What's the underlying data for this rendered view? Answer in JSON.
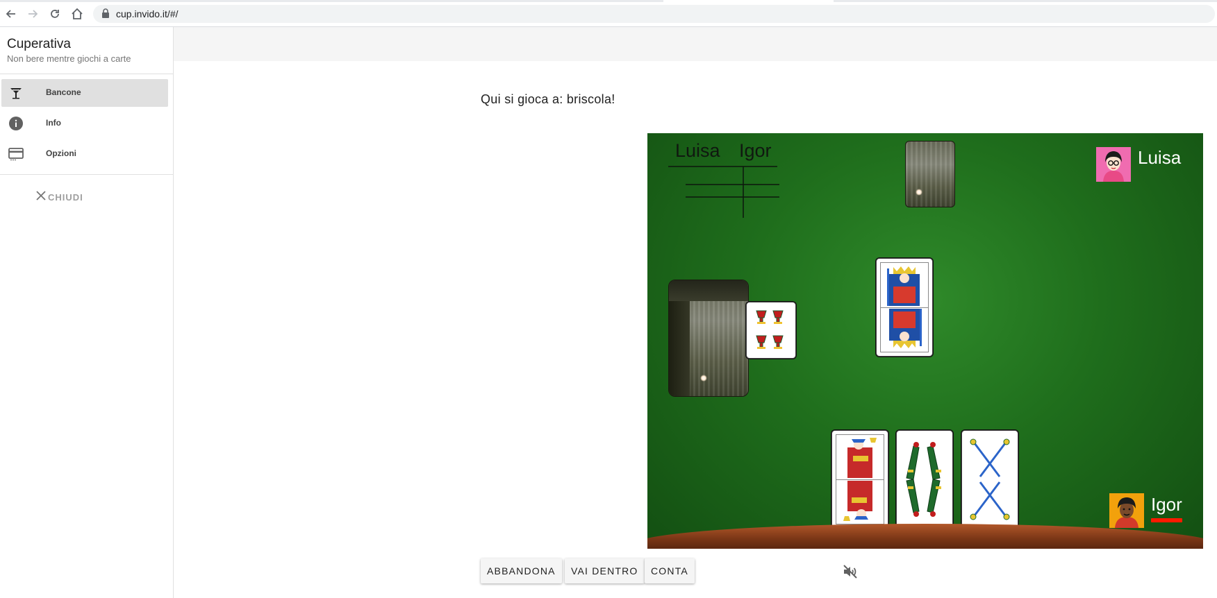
{
  "browser": {
    "url": "cup.invido.it/#/"
  },
  "sidebar": {
    "title": "Cuperativa",
    "subtitle": "Non bere mentre giochi a carte",
    "items": [
      {
        "label": "Bancone",
        "icon": "cocktail-glass-icon",
        "active": true
      },
      {
        "label": "Info",
        "icon": "info-icon",
        "active": false
      },
      {
        "label": "Opzioni",
        "icon": "credit-card-icon",
        "active": false
      }
    ],
    "close_label": "CHIUDI"
  },
  "main": {
    "heading": "Qui si gioca a: briscola!"
  },
  "game": {
    "score_players": [
      "Luisa",
      "Igor"
    ],
    "opponent": {
      "name": "Luisa",
      "avatar": "woman-avatar-icon"
    },
    "player": {
      "name": "Igor",
      "avatar": "man-avatar-icon",
      "is_turn": true
    },
    "table_cards": [
      "Re di Spade"
    ],
    "briscola_card": "Quattro di Coppe",
    "hand_cards": [
      "Fante di Coppe",
      "Quattro di Bastoni",
      "Quattro di Spade"
    ],
    "colors": {
      "felt": "#1f6e1c",
      "rim": "#7a3616",
      "turn_indicator": "#ff1a00"
    }
  },
  "actions": {
    "abandon_label": "ABBANDONA",
    "go_in_label": "VAI DENTRO",
    "count_label": "CONTA",
    "mute_icon": "volume-off-icon"
  }
}
